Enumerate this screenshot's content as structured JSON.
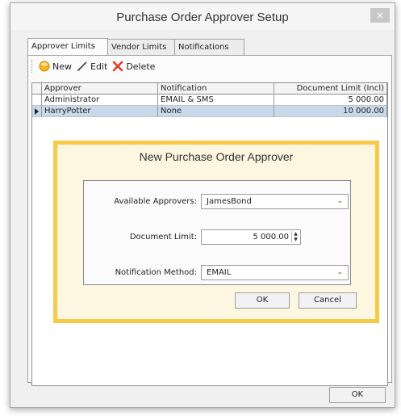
{
  "window": {
    "title": "Purchase Order Approver Setup",
    "close_glyph": "×"
  },
  "tabs": [
    {
      "label": "Approver Limits"
    },
    {
      "label": "Vendor Limits"
    },
    {
      "label": "Notifications"
    }
  ],
  "toolbar": {
    "new_label": "New",
    "edit_label": "Edit",
    "delete_label": "Delete"
  },
  "grid": {
    "columns": [
      "Approver",
      "Notification",
      "Document Limit (Incl)"
    ],
    "rows": [
      {
        "approver": "Administrator",
        "notification": "EMAIL & SMS",
        "limit": "5 000.00",
        "selected": false
      },
      {
        "approver": "HarryPotter",
        "notification": "None",
        "limit": "10 000.00",
        "selected": true
      }
    ]
  },
  "dialog": {
    "title": "New Purchase Order Approver",
    "available_label": "Available Approvers:",
    "available_value": "JamesBond",
    "limit_label": "Document Limit:",
    "limit_value": "5 000.00",
    "method_label": "Notification Method:",
    "method_value": "EMAIL",
    "ok_label": "OK",
    "cancel_label": "Cancel"
  },
  "footer": {
    "ok_label": "OK"
  },
  "colors": {
    "dialog_border": "#f7c948",
    "dialog_bg": "#fdf6e0",
    "selected_row": "#c9d9ec",
    "delete_icon": "#e23a2a"
  }
}
